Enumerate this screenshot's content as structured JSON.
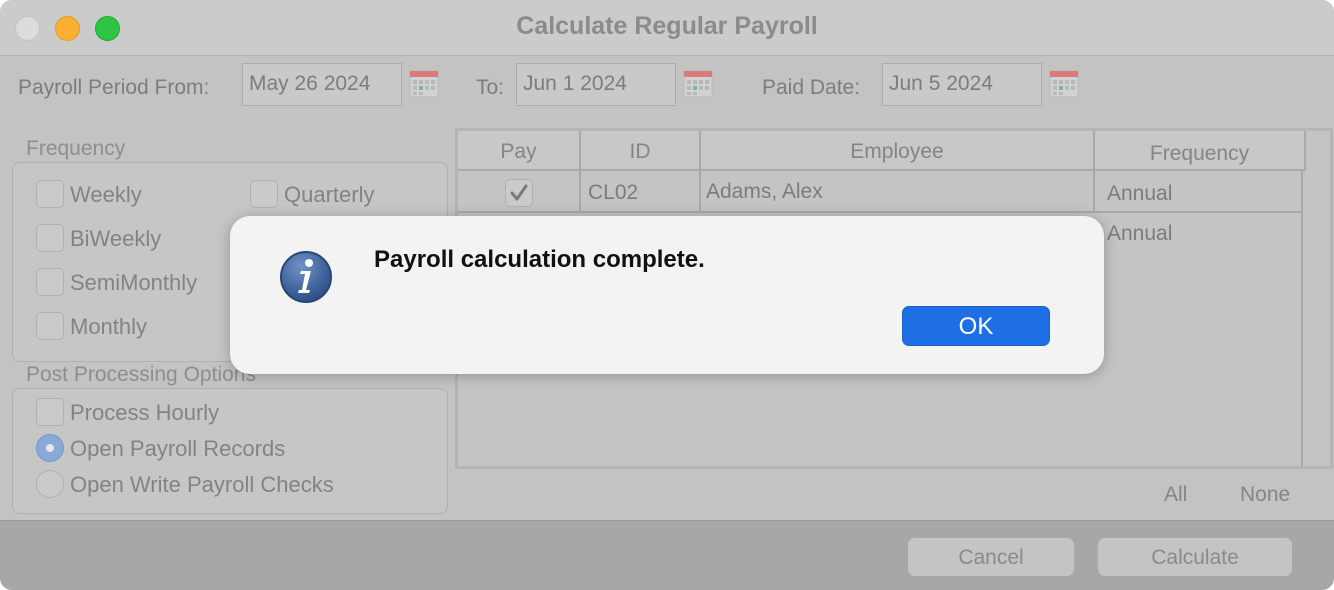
{
  "window": {
    "title": "Calculate Regular Payroll"
  },
  "period": {
    "from_label": "Payroll Period From:",
    "from_value": "May 26 2024",
    "to_label": "To:",
    "to_value": "Jun 1 2024",
    "paid_label": "Paid Date:",
    "paid_value": "Jun 5 2024"
  },
  "frequency": {
    "title": "Frequency",
    "options": [
      "Weekly",
      "Quarterly",
      "BiWeekly",
      "SemiMonthly",
      "Monthly"
    ]
  },
  "post_processing": {
    "title": "Post Processing Options",
    "process_hourly": "Process Hourly",
    "open_payroll_records": "Open Payroll Records",
    "open_write_checks": "Open Write Payroll Checks",
    "selected": "Open Payroll Records"
  },
  "table": {
    "columns": [
      "Pay",
      "ID",
      "Employee",
      "Frequency"
    ],
    "rows": [
      {
        "pay": true,
        "id": "CL02",
        "employee": "Adams, Alex",
        "frequency": "Annual"
      },
      {
        "pay": null,
        "id": "",
        "employee": "",
        "frequency": "Annual"
      }
    ]
  },
  "selection": {
    "all": "All",
    "none": "None"
  },
  "buttons": {
    "cancel": "Cancel",
    "calculate": "Calculate"
  },
  "dialog": {
    "message": "Payroll calculation complete.",
    "ok": "OK",
    "icon": "info-icon"
  },
  "colors": {
    "accent": "#1e6fe3",
    "radio_selected": "#8aa9d6"
  }
}
